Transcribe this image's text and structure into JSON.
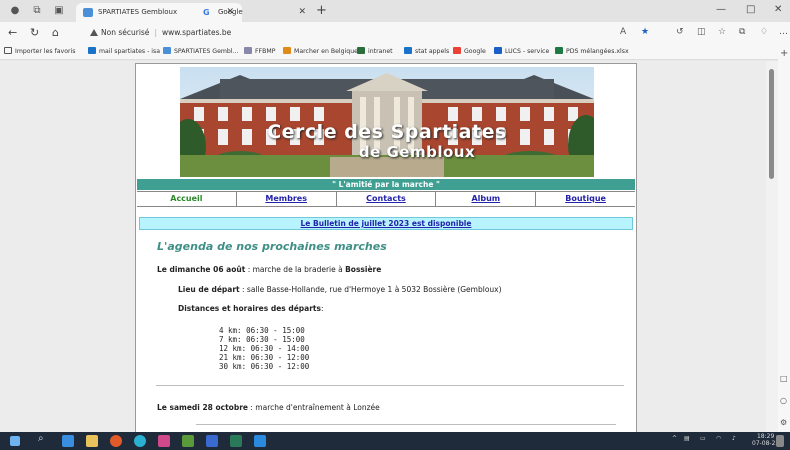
{
  "browser": {
    "tabs": [
      {
        "title": "SPARTIATES Gembloux",
        "active": true
      },
      {
        "title": "Google",
        "active": false
      }
    ],
    "address": {
      "warning": "Non sécurisé",
      "url": "www.spartiates.be"
    },
    "favorites": [
      "Importer les favoris",
      "mail spartiates - isa",
      "SPARTIATES Gembl...",
      "FFBMP",
      "Marcher en Belgique",
      "intranet",
      "stat appels",
      "Google",
      "LUCS - service",
      "PDS mélangées.xlsx"
    ]
  },
  "page": {
    "banner": {
      "line1": "Cercle des Spartiates",
      "line2": "de Gembloux"
    },
    "motto": "\" L'amitié par la marche \"",
    "menu": [
      "Accueil",
      "Membres",
      "Contacts",
      "Album",
      "Boutique"
    ],
    "bulletin": "Le Bulletin de juillet 2023 est disponible",
    "agenda_title": "L'agenda de nos prochaines marches",
    "event1": {
      "date": "Le dimanche 06 août",
      "text": " : marche de la braderie à ",
      "place": "Bossière",
      "depart_label": "Lieu de départ",
      "depart_text": " : salle Basse-Hollande, rue d'Hermoye 1 à 5032 Bossière (Gembloux)",
      "distances_label": "Distances et horaires des départs",
      "distances_colon": ":",
      "distances": [
        "4 km: 06:30 - 15:00",
        "7 km: 06:30 - 15:00",
        "12 km: 06:30 - 14:00",
        "21 km: 06:30 - 12:00",
        "30 km: 06:30 - 12:00"
      ]
    },
    "event2": {
      "date": "Le samedi 28 octobre",
      "text": " : marche d'entraînement à Lonzée"
    }
  },
  "taskbar": {
    "time": "18:29",
    "date": "07-08-23"
  }
}
